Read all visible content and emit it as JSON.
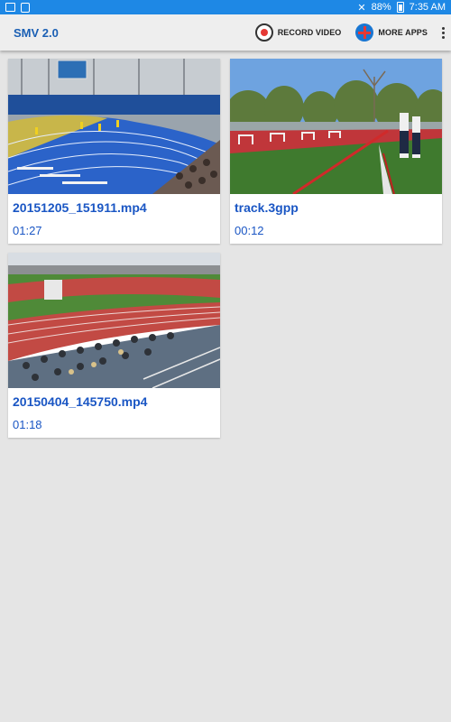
{
  "status_bar": {
    "battery": "88%",
    "time": "7:35 AM",
    "bg_color": "#1e88e5"
  },
  "app_bar": {
    "title": "SMV 2.0",
    "record_label": "RECORD VIDEO",
    "more_apps_label": "MORE APPS"
  },
  "videos": [
    {
      "title": "20151205_151911.mp4",
      "duration": "01:27"
    },
    {
      "title": "track.3gpp",
      "duration": "00:12"
    },
    {
      "title": "20150404_145750.mp4",
      "duration": "01:18"
    }
  ]
}
